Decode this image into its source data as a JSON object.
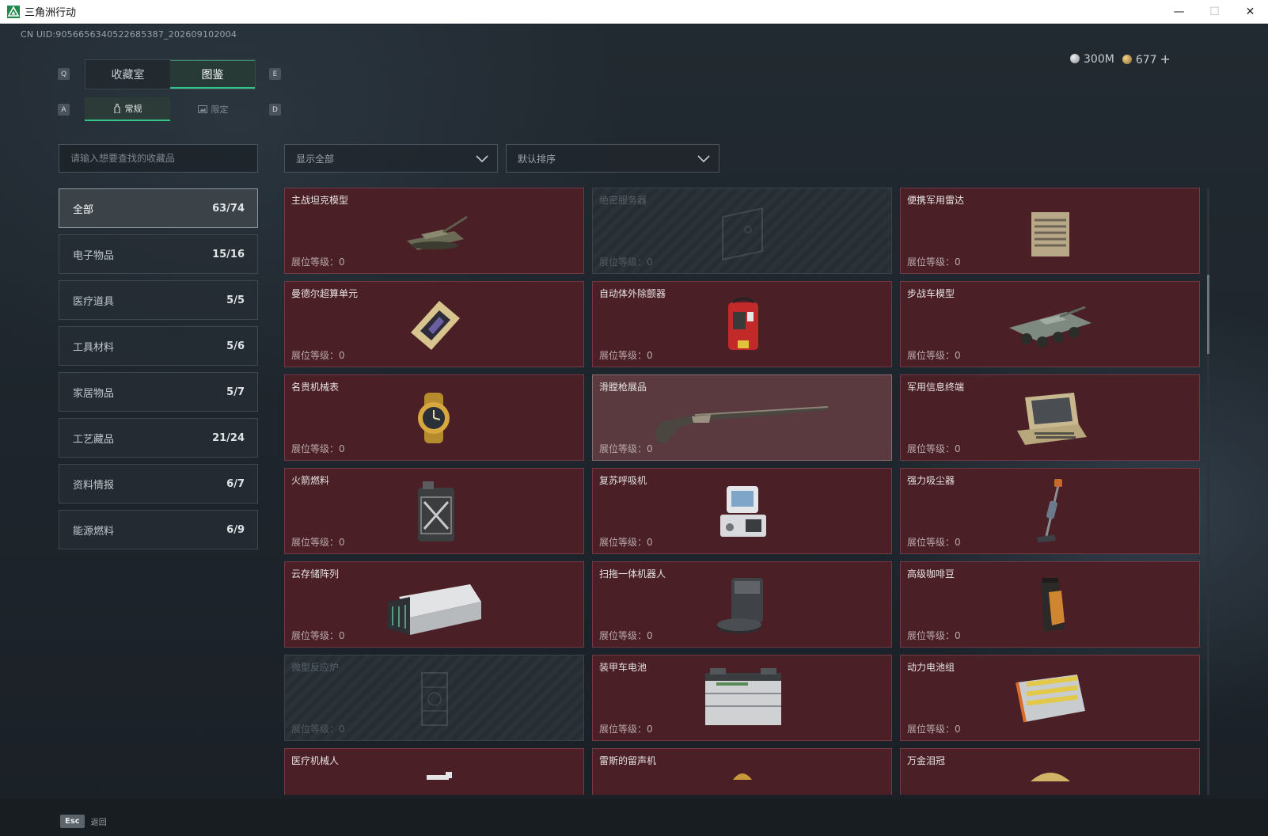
{
  "window": {
    "title": "三角洲行动",
    "min": "—",
    "max": "☐",
    "close": "✕"
  },
  "uid": "CN UID:9056656340522685387_202609102004",
  "currency": {
    "silver": "300M",
    "gold": "677",
    "plus": "+"
  },
  "keyhints": {
    "q": "Q",
    "e": "E",
    "a": "A",
    "d": "D"
  },
  "main_tabs": [
    {
      "label": "收藏室"
    },
    {
      "label": "图鉴"
    }
  ],
  "sub_tabs": [
    {
      "label": "常规"
    },
    {
      "label": "限定"
    }
  ],
  "search": {
    "placeholder": "请输入想要查找的收藏品"
  },
  "filters": {
    "show": "显示全部",
    "sort": "默认排序"
  },
  "categories": [
    {
      "label": "全部",
      "count": "63/74"
    },
    {
      "label": "电子物品",
      "count": "15/16"
    },
    {
      "label": "医疗道具",
      "count": "5/5"
    },
    {
      "label": "工具材料",
      "count": "5/6"
    },
    {
      "label": "家居物品",
      "count": "5/7"
    },
    {
      "label": "工艺藏品",
      "count": "21/24"
    },
    {
      "label": "资料情报",
      "count": "6/7"
    },
    {
      "label": "能源燃料",
      "count": "6/9"
    }
  ],
  "level_label": "展位等级：0",
  "items": [
    {
      "name": "主战坦克模型",
      "icon": "tank-icon"
    },
    {
      "name": "绝密服务器",
      "icon": "server-icon"
    },
    {
      "name": "便携军用雷达",
      "icon": "radar-icon"
    },
    {
      "name": "曼德尔超算单元",
      "icon": "chip-icon"
    },
    {
      "name": "自动体外除颤器",
      "icon": "defibrillator-icon"
    },
    {
      "name": "步战车模型",
      "icon": "ifv-icon"
    },
    {
      "name": "名贵机械表",
      "icon": "watch-icon"
    },
    {
      "name": "滑膛枪展品",
      "icon": "musket-icon"
    },
    {
      "name": "军用信息终端",
      "icon": "terminal-icon"
    },
    {
      "name": "火箭燃料",
      "icon": "fuel-can-icon"
    },
    {
      "name": "复苏呼吸机",
      "icon": "ventilator-icon"
    },
    {
      "name": "强力吸尘器",
      "icon": "vacuum-icon"
    },
    {
      "name": "云存储阵列",
      "icon": "storage-icon"
    },
    {
      "name": "扫拖一体机器人",
      "icon": "robot-vacuum-icon"
    },
    {
      "name": "高级咖啡豆",
      "icon": "coffee-bag-icon"
    },
    {
      "name": "微型反应炉",
      "icon": "reactor-icon"
    },
    {
      "name": "装甲车电池",
      "icon": "battery-icon"
    },
    {
      "name": "动力电池组",
      "icon": "battery-pack-icon"
    },
    {
      "name": "医疗机械人",
      "icon": "medical-robot-icon"
    },
    {
      "name": "雷斯的留声机",
      "icon": "phonograph-icon"
    },
    {
      "name": "万金泪冠",
      "icon": "crown-icon"
    }
  ],
  "bottom": {
    "esc_key": "Esc",
    "back": "返回"
  }
}
